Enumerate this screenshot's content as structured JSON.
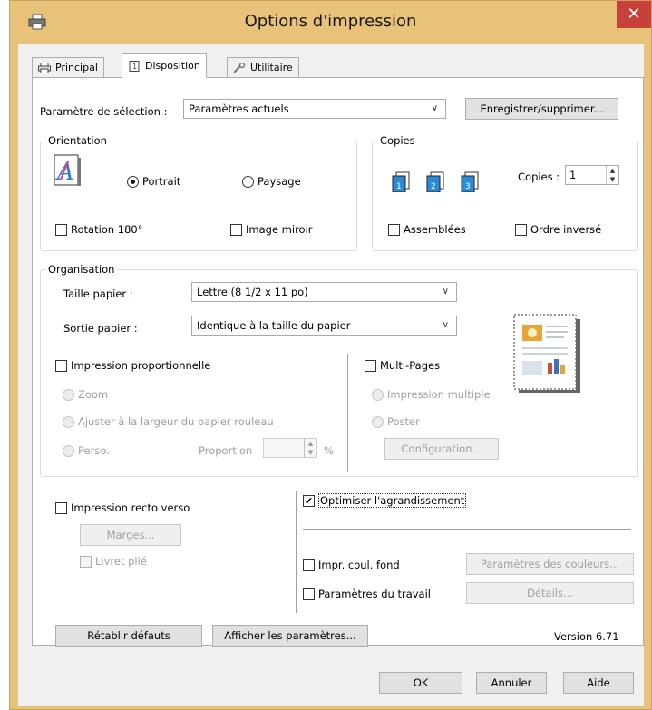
{
  "window": {
    "title": "Options d'impression",
    "close": "✕",
    "accent": "#e9c27a",
    "close_color": "#c7403a"
  },
  "tabs": [
    {
      "label": "Principal",
      "icon": "printer-icon"
    },
    {
      "label": "Disposition",
      "icon": "layout-page-icon"
    },
    {
      "label": "Utilitaire",
      "icon": "wrench-icon"
    }
  ],
  "selection": {
    "label": "Paramètre de sélection :",
    "value": "Paramètres actuels",
    "save_button": "Enregistrer/supprimer..."
  },
  "orientation": {
    "title": "Orientation",
    "portrait": "Portrait",
    "landscape": "Paysage",
    "selected": "Portrait",
    "rotate180": "Rotation 180°",
    "mirror": "Image miroir"
  },
  "copies": {
    "title": "Copies",
    "label": "Copies :",
    "value": "1",
    "collate": "Assemblées",
    "reverse": "Ordre inversé"
  },
  "organisation": {
    "title": "Organisation",
    "paper_size_label": "Taille papier :",
    "paper_size_value": "Lettre (8 1/2 x 11 po)",
    "paper_output_label": "Sortie papier :",
    "paper_output_value": "Identique à la taille du papier",
    "proportional": "Impression proportionnelle",
    "zoom": "Zoom",
    "fit_roll": "Ajuster à la largeur du papier rouleau",
    "custom": "Perso.",
    "proportion_label": "Proportion",
    "percent": "%",
    "multipages": "Multi-Pages",
    "multi_print": "Impression multiple",
    "poster": "Poster",
    "configuration": "Configuration..."
  },
  "duplex": {
    "label": "Impression recto verso",
    "margins": "Marges...",
    "booklet": "Livret plié"
  },
  "optimize": {
    "label": "Optimiser l'agrandissement",
    "checked": true
  },
  "background": {
    "label": "Impr. coul. fond",
    "color_settings": "Paramètres des couleurs..."
  },
  "job": {
    "label": "Paramètres du travail",
    "details": "Détails..."
  },
  "footer": {
    "reset": "Rétablir défauts",
    "show_settings": "Afficher les paramètres...",
    "version": "Version 6.71"
  },
  "dialog_buttons": {
    "ok": "OK",
    "cancel": "Annuler",
    "help": "Aide"
  }
}
